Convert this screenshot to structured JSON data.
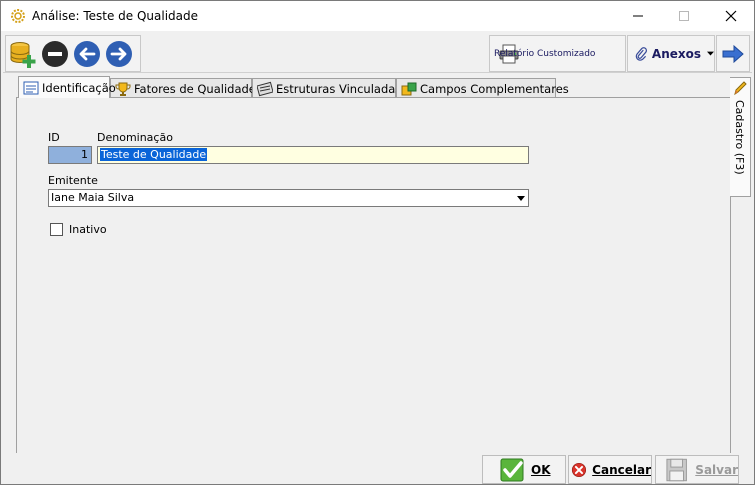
{
  "window": {
    "title": "Análise: Teste de Qualidade"
  },
  "toolbar": {
    "report_label": "Relatório Customizado",
    "attachments_label": "Anexos"
  },
  "tabs": [
    {
      "label": "Identificação",
      "active": true
    },
    {
      "label": "Fatores de Qualidade",
      "active": false
    },
    {
      "label": "Estruturas Vinculadas",
      "active": false
    },
    {
      "label": "Campos Complementares",
      "active": false
    }
  ],
  "side_tab": {
    "label": "Cadastro (F3)"
  },
  "form": {
    "id_label": "ID",
    "id_value": "1",
    "name_label": "Denominação",
    "name_value": "Teste de Qualidade",
    "issuer_label": "Emitente",
    "issuer_value": "Iane Maia Silva",
    "inactive_label": "Inativo",
    "inactive_checked": false
  },
  "footer": {
    "ok_label": "OK",
    "cancel_label": "Cancelar",
    "save_label": "Salvar"
  },
  "colors": {
    "accent": "#2f5fb3",
    "highlight_field": "#ffffe1",
    "selection": "#0a64d8"
  }
}
